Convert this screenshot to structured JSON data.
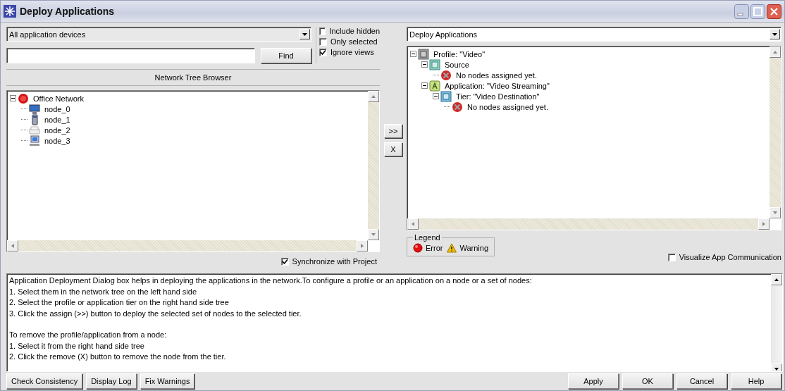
{
  "window": {
    "title": "Deploy Applications"
  },
  "left": {
    "device_filter": "All application devices",
    "find_button": "Find",
    "options": [
      {
        "label": "Include hidden",
        "checked": false
      },
      {
        "label": "Only selected",
        "checked": false
      },
      {
        "label": "Ignore views",
        "checked": true
      }
    ],
    "panel_title": "Network Tree Browser",
    "tree": [
      {
        "label": "Office Network",
        "kind": "network",
        "expanded": true,
        "children": [
          {
            "label": "node_0",
            "kind": "monitor"
          },
          {
            "label": "node_1",
            "kind": "server"
          },
          {
            "label": "node_2",
            "kind": "printer"
          },
          {
            "label": "node_3",
            "kind": "computer"
          }
        ]
      }
    ],
    "sync": {
      "label": "Synchronize with Project",
      "checked": true
    }
  },
  "transfer_buttons": [
    ">>",
    "X"
  ],
  "right": {
    "view": "Deploy Applications",
    "tree": [
      {
        "label": "Profile: \"Video\"",
        "kind": "profile",
        "expanded": true,
        "children": [
          {
            "label": "Source",
            "kind": "source",
            "expanded": true,
            "children": [
              {
                "label": "No nodes assigned yet.",
                "kind": "error"
              }
            ]
          },
          {
            "label": "Application: \"Video Streaming\"",
            "kind": "application",
            "expanded": true,
            "children": [
              {
                "label": "Tier: \"Video Destination\"",
                "kind": "tier",
                "expanded": true,
                "children": [
                  {
                    "label": "No nodes assigned yet.",
                    "kind": "error"
                  }
                ]
              }
            ]
          }
        ]
      }
    ],
    "legend": {
      "title": "Legend",
      "items": [
        {
          "label": "Error",
          "kind": "error"
        },
        {
          "label": "Warning",
          "kind": "warning"
        }
      ]
    },
    "visualize": {
      "label": "Visualize App Communication",
      "checked": false
    }
  },
  "help_text": [
    [
      "Application Deployment Dialog box helps in deploying the applications in the network.To configure a profile or an application on a node or a set of nodes:",
      "1. Select them in the network tree on the left hand side",
      "2. Select the profile or application tier on the right hand side tree",
      "3. Click the assign (>>) button to deploy the selected set of nodes to the selected tier."
    ],
    [
      "To remove the profile/application from a node:",
      "1. Select it from the right hand side tree",
      "2. Click the remove (X) button to remove the node from the tier."
    ]
  ],
  "buttons_left": [
    "Check Consistency",
    "Display Log",
    "Fix Warnings"
  ],
  "buttons_right": [
    "Apply",
    "OK",
    "Cancel",
    "Help"
  ]
}
